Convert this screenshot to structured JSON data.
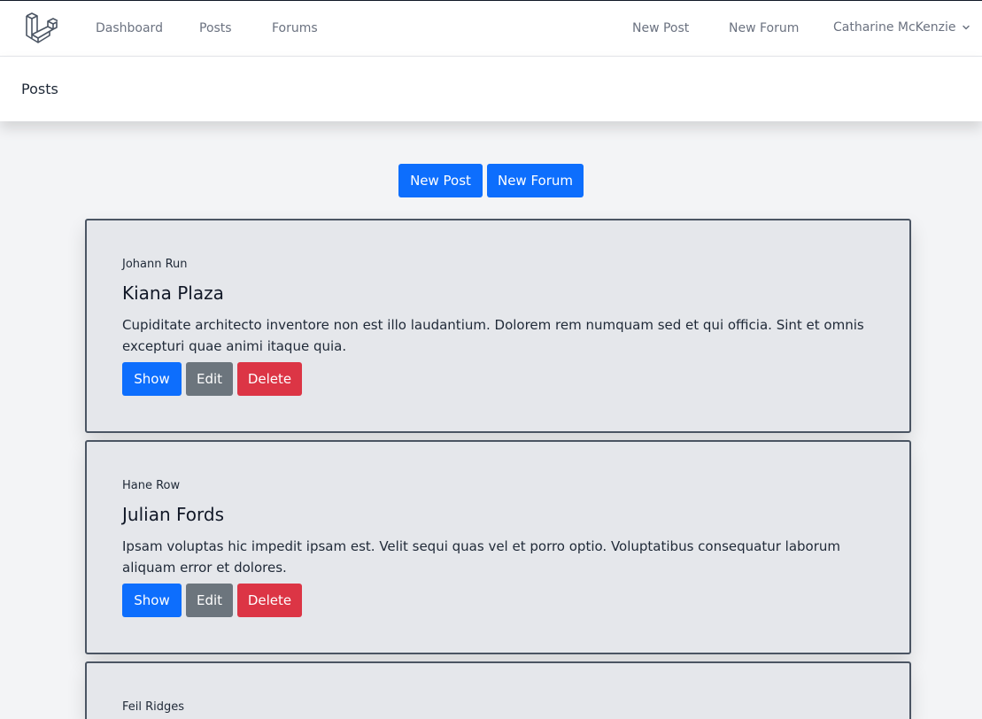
{
  "nav": {
    "links": [
      "Dashboard",
      "Posts",
      "Forums"
    ],
    "right_links": [
      "New Post",
      "New Forum"
    ],
    "user_name": "Catharine McKenzie"
  },
  "header": {
    "title": "Posts"
  },
  "actions": {
    "new_post": "New Post",
    "new_forum": "New Forum"
  },
  "posts": [
    {
      "author": "Johann Run",
      "title": "Kiana Plaza",
      "body": "Cupiditate architecto inventore non est illo laudantium. Dolorem rem numquam sed et qui officia. Sint et omnis excepturi quae animi itaque quia.",
      "show": "Show",
      "edit": "Edit",
      "delete": "Delete"
    },
    {
      "author": "Hane Row",
      "title": "Julian Fords",
      "body": "Ipsam voluptas hic impedit ipsam est. Velit sequi quas vel et porro optio. Voluptatibus consequatur laborum aliquam error et dolores.",
      "show": "Show",
      "edit": "Edit",
      "delete": "Delete"
    },
    {
      "author": "Feil Ridges"
    }
  ],
  "colors": {
    "primary": "#0d6efd",
    "secondary": "#6c757d",
    "danger": "#dc3545",
    "card_bg": "#e5e7eb",
    "page_bg": "#f3f4f6"
  }
}
